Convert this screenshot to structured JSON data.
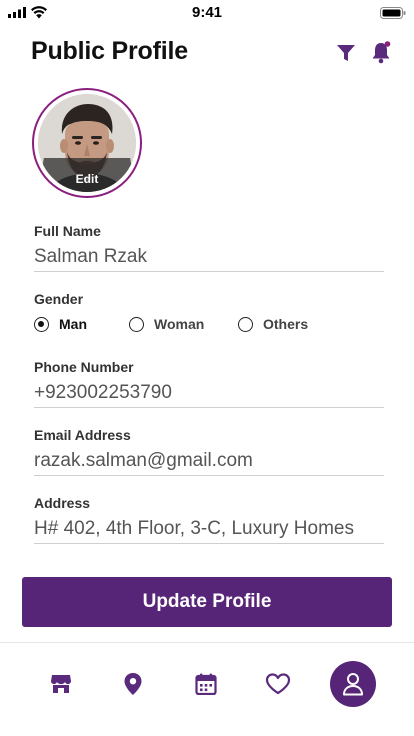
{
  "status_bar": {
    "time": "9:41"
  },
  "header": {
    "title": "Public Profile",
    "icons": [
      "filter-icon",
      "bell-icon"
    ]
  },
  "avatar": {
    "edit_label": "Edit"
  },
  "form": {
    "full_name": {
      "label": "Full Name",
      "value": "Salman Rzak"
    },
    "gender": {
      "label": "Gender",
      "options": [
        {
          "label": "Man",
          "selected": true
        },
        {
          "label": "Woman",
          "selected": false
        },
        {
          "label": "Others",
          "selected": false
        }
      ]
    },
    "phone": {
      "label": "Phone Number",
      "value": "+923002253790"
    },
    "email": {
      "label": "Email Address",
      "value": "razak.salman@gmail.com"
    },
    "address": {
      "label": "Address",
      "value": "H# 402, 4th Floor, 3-C, Luxury Homes"
    }
  },
  "update_button": {
    "label": "Update Profile"
  },
  "bottom_nav": {
    "items": [
      "store-icon",
      "location-pin-icon",
      "calendar-icon",
      "heart-icon",
      "user-icon"
    ],
    "active": "user-icon"
  },
  "colors": {
    "accent": "#572578",
    "avatar_ring": "#8a1f7f"
  }
}
